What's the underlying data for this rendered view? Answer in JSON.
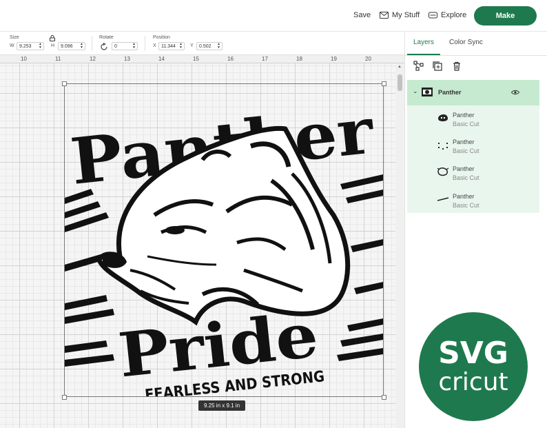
{
  "header": {
    "save_label": "Save",
    "mystuff_label": "My Stuff",
    "explore_label": "Explore",
    "make_label": "Make"
  },
  "properties": {
    "size_label": "Size",
    "w_label": "W",
    "w_value": "9.253",
    "h_label": "H",
    "h_value": "9.096",
    "rotate_label": "Rotate",
    "rotate_value": "0",
    "position_label": "Position",
    "x_label": "X",
    "x_value": "11.344",
    "y_label": "Y",
    "y_value": "0.502"
  },
  "ruler": {
    "ticks": [
      "10",
      "11",
      "12",
      "13",
      "14",
      "15",
      "16",
      "17",
      "18",
      "19",
      "20"
    ]
  },
  "canvas": {
    "size_chip": "9.25  in x 9.1  in"
  },
  "design": {
    "word_panther": "Panther",
    "word_pride": "Pride",
    "tagline": "FEARLESS AND STRONG"
  },
  "panel": {
    "tab_layers": "Layers",
    "tab_colorsync": "Color Sync",
    "group_name": "Panther",
    "layers": [
      {
        "name": "Panther",
        "sub": "Basic Cut"
      },
      {
        "name": "Panther",
        "sub": "Basic Cut"
      },
      {
        "name": "Panther",
        "sub": "Basic Cut"
      },
      {
        "name": "Panther",
        "sub": "Basic Cut"
      }
    ]
  },
  "badge": {
    "line1": "SVG",
    "line2": "cricut"
  },
  "colors": {
    "accent": "#1e7a4e",
    "group_header": "#c5eacf",
    "group_body": "#e9f6ee"
  }
}
